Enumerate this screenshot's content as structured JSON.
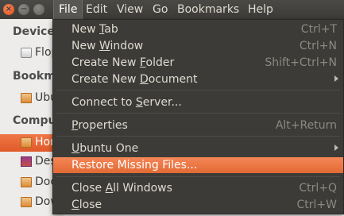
{
  "menubar": {
    "close_glyph": "×",
    "min_glyph": "−",
    "menus": [
      "File",
      "Edit",
      "View",
      "Go",
      "Bookmarks",
      "Help"
    ],
    "active_menu": "File"
  },
  "sidebar": {
    "sections": [
      {
        "header": "Devices",
        "items": [
          {
            "label": "Floppy",
            "icon": "floppy-drive-icon"
          }
        ]
      },
      {
        "header": "Bookmarks",
        "items": [
          {
            "label": "Ubuntu",
            "icon": "folder-icon"
          }
        ]
      },
      {
        "header": "Computer",
        "items": [
          {
            "label": "Home",
            "icon": "home-folder-icon",
            "selected": true
          },
          {
            "label": "Desktop",
            "icon": "desktop-icon"
          },
          {
            "label": "Documents",
            "icon": "folder-icon"
          },
          {
            "label": "Downloads",
            "icon": "folder-icon"
          }
        ]
      }
    ]
  },
  "file_menu": {
    "items": [
      {
        "label": "New Tab",
        "mnemonic": "T",
        "accel": "Ctrl+T"
      },
      {
        "label": "New Window",
        "mnemonic": "W",
        "accel": "Ctrl+N"
      },
      {
        "label": "Create New Folder",
        "mnemonic": "F",
        "accel": "Shift+Ctrl+N"
      },
      {
        "label": "Create New Document",
        "mnemonic": "D",
        "submenu": true
      },
      {
        "label": "Connect to Server...",
        "mnemonic": "S",
        "accel": ""
      },
      {
        "label": "Properties",
        "mnemonic": "P",
        "accel": "Alt+Return"
      },
      {
        "label": "Ubuntu One",
        "mnemonic": "U",
        "submenu": true
      },
      {
        "label": "Restore Missing Files...",
        "accel": "",
        "highlighted": true
      },
      {
        "label": "Close All Windows",
        "mnemonic": "A",
        "accel": "Ctrl+Q"
      },
      {
        "label": "Close",
        "mnemonic": "C",
        "accel": "Ctrl+W"
      }
    ]
  },
  "colors": {
    "accent": "#e26a34",
    "menu_bg": "#3c3b37",
    "menu_text": "#dfdbd2",
    "accel_text": "#8b8983"
  }
}
